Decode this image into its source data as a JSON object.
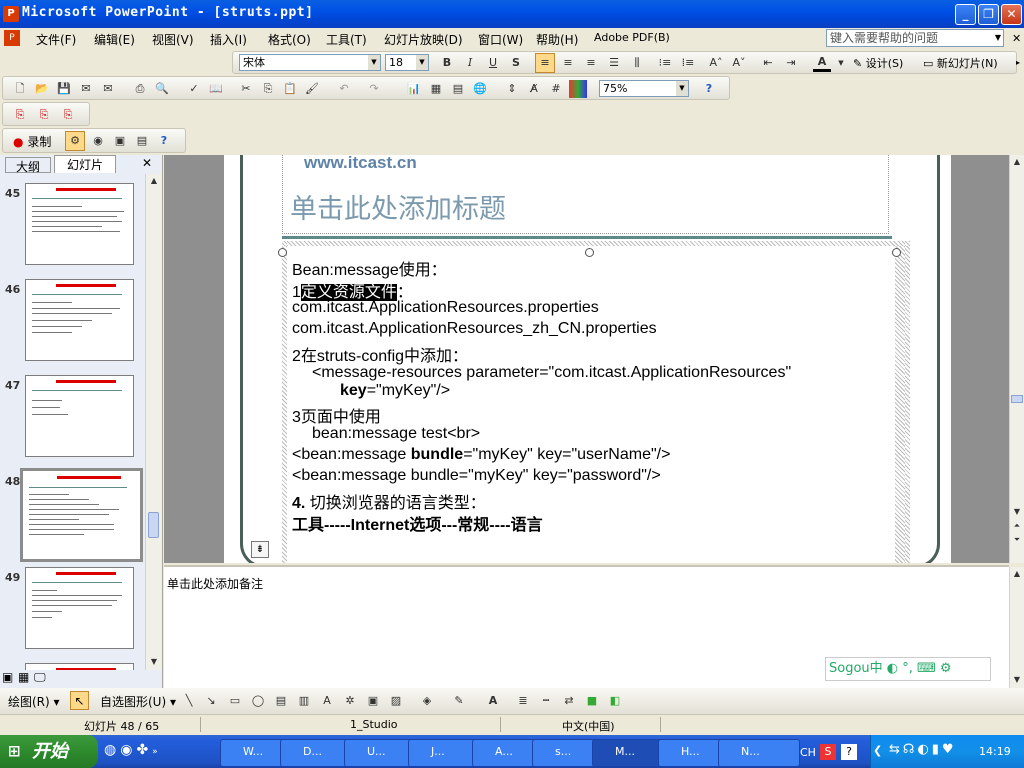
{
  "window": {
    "title": "Microsoft PowerPoint - [struts.ppt]",
    "app_icon": "powerpoint-icon"
  },
  "menu": {
    "items": [
      "文件(F)",
      "编辑(E)",
      "视图(V)",
      "插入(I)",
      "格式(O)",
      "工具(T)",
      "幻灯片放映(D)",
      "窗口(W)",
      "帮助(H)",
      "Adobe PDF(B)"
    ],
    "help_placeholder": "键入需要帮助的问题"
  },
  "format_toolbar": {
    "font": "宋体",
    "size": "18",
    "design_label": "设计(S)",
    "new_slide_label": "新幻灯片(N)"
  },
  "standard_toolbar": {
    "zoom": "75%"
  },
  "record_toolbar": {
    "record_label": "录制"
  },
  "left_panel": {
    "tabs": [
      "大纲",
      "幻灯片"
    ],
    "thumbnails": [
      {
        "num": "45",
        "selected": false
      },
      {
        "num": "46",
        "selected": false
      },
      {
        "num": "47",
        "selected": false
      },
      {
        "num": "48",
        "selected": true
      },
      {
        "num": "49",
        "selected": false
      }
    ]
  },
  "slide": {
    "site": "www.itcast.cn",
    "title_placeholder": "单击此处添加标题",
    "lines": {
      "l1": "Bean:message使用：",
      "l2_pre": "1",
      "l2_hl": "定义资源文件",
      "l2_post": "：",
      "l3": "com.itcast.ApplicationResources.properties",
      "l4": " com.itcast.ApplicationResources_zh_CN.properties",
      "l5": "2在struts-config中添加：",
      "l6": "<message-resources parameter=\"com.itcast.ApplicationResources\"",
      "l7_b": "key",
      "l7_r": "=\"myKey\"/>",
      "l8": "3页面中使用",
      "l9": "bean:message test<br>",
      "l10_a": "<bean:message ",
      "l10_b": "bundle",
      "l10_c": "=\"myKey\" key=\"userName\"/>",
      "l11_a": "<bean:message bundle=\"myKey\" key=\"password\"/>",
      "l12_a": "4.",
      "l12_b": " 切换浏览器的语言类型：",
      "l13": "工具-----Internet选项---常规----语言"
    }
  },
  "notes": {
    "placeholder": "单击此处添加备注"
  },
  "draw_toolbar": {
    "draw_label": "绘图(R)",
    "autoshape_label": "自选图形(U)"
  },
  "status": {
    "slide": "幻灯片 48 / 65",
    "design": "1_Studio",
    "language": "中文(中国)"
  },
  "ime": {
    "label": "Sogou中"
  },
  "taskbar": {
    "start": "开始",
    "tasks": [
      "W...",
      "D...",
      "U...",
      "J...",
      "A...",
      "s...",
      "M...",
      "H...",
      "N..."
    ],
    "tray_lang": "CH",
    "clock": "14:19"
  }
}
